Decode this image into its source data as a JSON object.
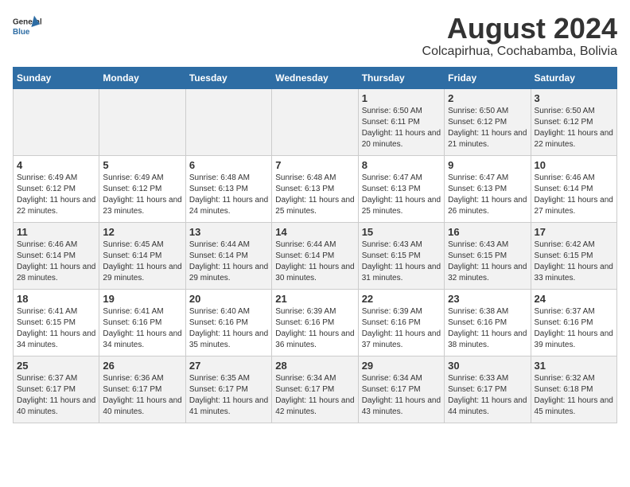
{
  "logo": {
    "line1": "General",
    "line2": "Blue"
  },
  "title": "August 2024",
  "subtitle": "Colcapirhua, Cochabamba, Bolivia",
  "days_of_week": [
    "Sunday",
    "Monday",
    "Tuesday",
    "Wednesday",
    "Thursday",
    "Friday",
    "Saturday"
  ],
  "weeks": [
    [
      {
        "day": "",
        "info": ""
      },
      {
        "day": "",
        "info": ""
      },
      {
        "day": "",
        "info": ""
      },
      {
        "day": "",
        "info": ""
      },
      {
        "day": "1",
        "info": "Sunrise: 6:50 AM\nSunset: 6:11 PM\nDaylight: 11 hours and 20 minutes."
      },
      {
        "day": "2",
        "info": "Sunrise: 6:50 AM\nSunset: 6:12 PM\nDaylight: 11 hours and 21 minutes."
      },
      {
        "day": "3",
        "info": "Sunrise: 6:50 AM\nSunset: 6:12 PM\nDaylight: 11 hours and 22 minutes."
      }
    ],
    [
      {
        "day": "4",
        "info": "Sunrise: 6:49 AM\nSunset: 6:12 PM\nDaylight: 11 hours and 22 minutes."
      },
      {
        "day": "5",
        "info": "Sunrise: 6:49 AM\nSunset: 6:12 PM\nDaylight: 11 hours and 23 minutes."
      },
      {
        "day": "6",
        "info": "Sunrise: 6:48 AM\nSunset: 6:13 PM\nDaylight: 11 hours and 24 minutes."
      },
      {
        "day": "7",
        "info": "Sunrise: 6:48 AM\nSunset: 6:13 PM\nDaylight: 11 hours and 25 minutes."
      },
      {
        "day": "8",
        "info": "Sunrise: 6:47 AM\nSunset: 6:13 PM\nDaylight: 11 hours and 25 minutes."
      },
      {
        "day": "9",
        "info": "Sunrise: 6:47 AM\nSunset: 6:13 PM\nDaylight: 11 hours and 26 minutes."
      },
      {
        "day": "10",
        "info": "Sunrise: 6:46 AM\nSunset: 6:14 PM\nDaylight: 11 hours and 27 minutes."
      }
    ],
    [
      {
        "day": "11",
        "info": "Sunrise: 6:46 AM\nSunset: 6:14 PM\nDaylight: 11 hours and 28 minutes."
      },
      {
        "day": "12",
        "info": "Sunrise: 6:45 AM\nSunset: 6:14 PM\nDaylight: 11 hours and 29 minutes."
      },
      {
        "day": "13",
        "info": "Sunrise: 6:44 AM\nSunset: 6:14 PM\nDaylight: 11 hours and 29 minutes."
      },
      {
        "day": "14",
        "info": "Sunrise: 6:44 AM\nSunset: 6:14 PM\nDaylight: 11 hours and 30 minutes."
      },
      {
        "day": "15",
        "info": "Sunrise: 6:43 AM\nSunset: 6:15 PM\nDaylight: 11 hours and 31 minutes."
      },
      {
        "day": "16",
        "info": "Sunrise: 6:43 AM\nSunset: 6:15 PM\nDaylight: 11 hours and 32 minutes."
      },
      {
        "day": "17",
        "info": "Sunrise: 6:42 AM\nSunset: 6:15 PM\nDaylight: 11 hours and 33 minutes."
      }
    ],
    [
      {
        "day": "18",
        "info": "Sunrise: 6:41 AM\nSunset: 6:15 PM\nDaylight: 11 hours and 34 minutes."
      },
      {
        "day": "19",
        "info": "Sunrise: 6:41 AM\nSunset: 6:16 PM\nDaylight: 11 hours and 34 minutes."
      },
      {
        "day": "20",
        "info": "Sunrise: 6:40 AM\nSunset: 6:16 PM\nDaylight: 11 hours and 35 minutes."
      },
      {
        "day": "21",
        "info": "Sunrise: 6:39 AM\nSunset: 6:16 PM\nDaylight: 11 hours and 36 minutes."
      },
      {
        "day": "22",
        "info": "Sunrise: 6:39 AM\nSunset: 6:16 PM\nDaylight: 11 hours and 37 minutes."
      },
      {
        "day": "23",
        "info": "Sunrise: 6:38 AM\nSunset: 6:16 PM\nDaylight: 11 hours and 38 minutes."
      },
      {
        "day": "24",
        "info": "Sunrise: 6:37 AM\nSunset: 6:16 PM\nDaylight: 11 hours and 39 minutes."
      }
    ],
    [
      {
        "day": "25",
        "info": "Sunrise: 6:37 AM\nSunset: 6:17 PM\nDaylight: 11 hours and 40 minutes."
      },
      {
        "day": "26",
        "info": "Sunrise: 6:36 AM\nSunset: 6:17 PM\nDaylight: 11 hours and 40 minutes."
      },
      {
        "day": "27",
        "info": "Sunrise: 6:35 AM\nSunset: 6:17 PM\nDaylight: 11 hours and 41 minutes."
      },
      {
        "day": "28",
        "info": "Sunrise: 6:34 AM\nSunset: 6:17 PM\nDaylight: 11 hours and 42 minutes."
      },
      {
        "day": "29",
        "info": "Sunrise: 6:34 AM\nSunset: 6:17 PM\nDaylight: 11 hours and 43 minutes."
      },
      {
        "day": "30",
        "info": "Sunrise: 6:33 AM\nSunset: 6:17 PM\nDaylight: 11 hours and 44 minutes."
      },
      {
        "day": "31",
        "info": "Sunrise: 6:32 AM\nSunset: 6:18 PM\nDaylight: 11 hours and 45 minutes."
      }
    ]
  ]
}
